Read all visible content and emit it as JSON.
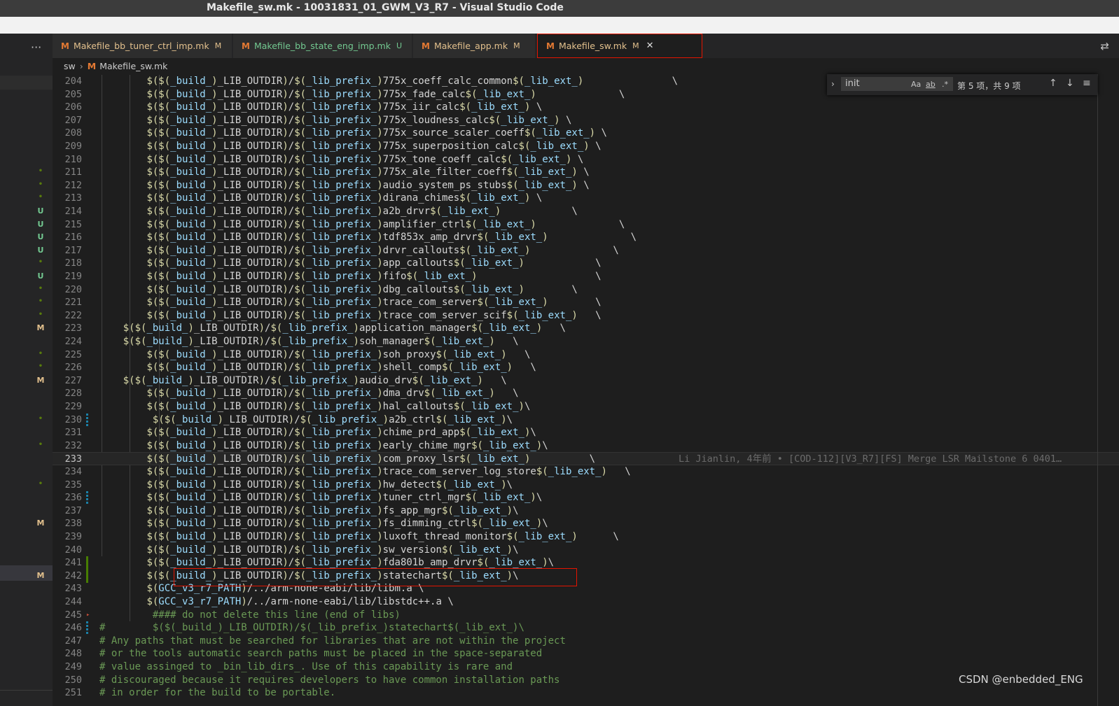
{
  "window": {
    "title": "Makefile_sw.mk - 10031831_01_GWM_V3_R7 - Visual Studio Code"
  },
  "tabs": [
    {
      "label": "Makefile_bb_tuner_ctrl_imp.mk",
      "status": "M",
      "status_color": "#e2c08d",
      "text_color": "#e2c08d"
    },
    {
      "label": "Makefile_bb_state_eng_imp.mk",
      "status": "U",
      "status_color": "#73c991",
      "text_color": "#73c991"
    },
    {
      "label": "Makefile_app.mk",
      "status": "M",
      "status_color": "#e2c08d",
      "text_color": "#e2c08d"
    },
    {
      "label": "Makefile_sw.mk",
      "status": "M",
      "status_color": "#e2c08d",
      "text_color": "#e2c08d",
      "active": true,
      "close": "✕"
    }
  ],
  "tab_icon_glyph": "M",
  "more_glyph": "···",
  "breadcrumb": {
    "folder": "sw",
    "separator": "›",
    "file": "Makefile_sw.mk"
  },
  "find": {
    "query": "init",
    "match_case": "Aa",
    "whole_word": "ab",
    "regex": ".*",
    "result": "第 5 项，共 9 项",
    "prev": "↑",
    "next": "↓",
    "menu": "≡",
    "toggle": "›"
  },
  "blame": "Li Jianlin, 4年前 • [COD-112][V3_R7][FS] Merge LSR Mailstone 6 0401…",
  "watermark": "CSDN @enbedded_ENG",
  "scm_markers": [
    {
      "line": 211,
      "t": "•"
    },
    {
      "line": 212,
      "t": "•"
    },
    {
      "line": 213,
      "t": "•"
    },
    {
      "line": 214,
      "t": "U"
    },
    {
      "line": 215,
      "t": "U"
    },
    {
      "line": 216,
      "t": "U"
    },
    {
      "line": 217,
      "t": "U"
    },
    {
      "line": 218,
      "t": "•"
    },
    {
      "line": 219,
      "t": "U"
    },
    {
      "line": 220,
      "t": "•"
    },
    {
      "line": 221,
      "t": "•"
    },
    {
      "line": 222,
      "t": "•"
    },
    {
      "line": 223,
      "t": "M"
    },
    {
      "line": 225,
      "t": "•"
    },
    {
      "line": 226,
      "t": "•"
    },
    {
      "line": 227,
      "t": "M"
    },
    {
      "line": 230,
      "t": "•"
    },
    {
      "line": 232,
      "t": "•"
    },
    {
      "line": 235,
      "t": "•"
    },
    {
      "line": 238,
      "t": "M"
    },
    {
      "line": 242,
      "t": "M"
    }
  ],
  "lines": [
    {
      "n": "204",
      "t": "        $($(_build_)_LIB_OUTDIR)/$(_lib_prefix_)775x_coeff_calc_common$(_lib_ext_)               \\"
    },
    {
      "n": "205",
      "t": "        $($(_build_)_LIB_OUTDIR)/$(_lib_prefix_)775x_fade_calc$(_lib_ext_)              \\"
    },
    {
      "n": "206",
      "t": "        $($(_build_)_LIB_OUTDIR)/$(_lib_prefix_)775x_iir_calc$(_lib_ext_) \\"
    },
    {
      "n": "207",
      "t": "        $($(_build_)_LIB_OUTDIR)/$(_lib_prefix_)775x_loudness_calc$(_lib_ext_) \\"
    },
    {
      "n": "208",
      "t": "        $($(_build_)_LIB_OUTDIR)/$(_lib_prefix_)775x_source_scaler_coeff$(_lib_ext_) \\"
    },
    {
      "n": "209",
      "t": "        $($(_build_)_LIB_OUTDIR)/$(_lib_prefix_)775x_superposition_calc$(_lib_ext_) \\"
    },
    {
      "n": "210",
      "t": "        $($(_build_)_LIB_OUTDIR)/$(_lib_prefix_)775x_tone_coeff_calc$(_lib_ext_) \\"
    },
    {
      "n": "211",
      "t": "        $($(_build_)_LIB_OUTDIR)/$(_lib_prefix_)775x_ale_filter_coeff$(_lib_ext_) \\"
    },
    {
      "n": "212",
      "t": "        $($(_build_)_LIB_OUTDIR)/$(_lib_prefix_)audio_system_ps_stubs$(_lib_ext_) \\"
    },
    {
      "n": "213",
      "t": "        $($(_build_)_LIB_OUTDIR)/$(_lib_prefix_)dirana_chimes$(_lib_ext_) \\"
    },
    {
      "n": "214",
      "t": "        $($(_build_)_LIB_OUTDIR)/$(_lib_prefix_)a2b_drvr$(_lib_ext_)            \\"
    },
    {
      "n": "215",
      "t": "        $($(_build_)_LIB_OUTDIR)/$(_lib_prefix_)amplifier_ctrl$(_lib_ext_)              \\"
    },
    {
      "n": "216",
      "t": "        $($(_build_)_LIB_OUTDIR)/$(_lib_prefix_)tdf853x_amp_drvr$(_lib_ext_)              \\"
    },
    {
      "n": "217",
      "t": "        $($(_build_)_LIB_OUTDIR)/$(_lib_prefix_)drvr_callouts$(_lib_ext_)              \\"
    },
    {
      "n": "218",
      "t": "        $($(_build_)_LIB_OUTDIR)/$(_lib_prefix_)app_callouts$(_lib_ext_)            \\"
    },
    {
      "n": "219",
      "t": "        $($(_build_)_LIB_OUTDIR)/$(_lib_prefix_)fifo$(_lib_ext_)                    \\"
    },
    {
      "n": "220",
      "t": "        $($(_build_)_LIB_OUTDIR)/$(_lib_prefix_)dbg_callouts$(_lib_ext_)        \\"
    },
    {
      "n": "221",
      "t": "        $($(_build_)_LIB_OUTDIR)/$(_lib_prefix_)trace_com_server$(_lib_ext_)        \\"
    },
    {
      "n": "222",
      "t": "        $($(_build_)_LIB_OUTDIR)/$(_lib_prefix_)trace_com_server_scif$(_lib_ext_)   \\"
    },
    {
      "n": "223",
      "t": "    $($(_build_)_LIB_OUTDIR)/$(_lib_prefix_)application_manager$(_lib_ext_)   \\"
    },
    {
      "n": "224",
      "t": "    $($(_build_)_LIB_OUTDIR)/$(_lib_prefix_)soh_manager$(_lib_ext_)   \\"
    },
    {
      "n": "225",
      "t": "        $($(_build_)_LIB_OUTDIR)/$(_lib_prefix_)soh_proxy$(_lib_ext_)   \\"
    },
    {
      "n": "226",
      "t": "        $($(_build_)_LIB_OUTDIR)/$(_lib_prefix_)shell_comp$(_lib_ext_)   \\"
    },
    {
      "n": "227",
      "t": "    $($(_build_)_LIB_OUTDIR)/$(_lib_prefix_)audio_drv$(_lib_ext_)   \\"
    },
    {
      "n": "228",
      "t": "        $($(_build_)_LIB_OUTDIR)/$(_lib_prefix_)dma_drv$(_lib_ext_)   \\"
    },
    {
      "n": "229",
      "t": "        $($(_build_)_LIB_OUTDIR)/$(_lib_prefix_)hal_callouts$(_lib_ext_)\\"
    },
    {
      "n": "230",
      "t": "         $($(_build_)_LIB_OUTDIR)/$(_lib_prefix_)a2b_ctrl$(_lib_ext_)\\"
    },
    {
      "n": "231",
      "t": "        $($(_build_)_LIB_OUTDIR)/$(_lib_prefix_)chime_prd_app$(_lib_ext_)\\"
    },
    {
      "n": "232",
      "t": "        $($(_build_)_LIB_OUTDIR)/$(_lib_prefix_)early_chime_mgr$(_lib_ext_)\\"
    },
    {
      "n": "233",
      "t": "        $($(_build_)_LIB_OUTDIR)/$(_lib_prefix_)com_proxy_lsr$(_lib_ext_)          \\",
      "current": true
    },
    {
      "n": "234",
      "t": "        $($(_build_)_LIB_OUTDIR)/$(_lib_prefix_)trace_com_server_log_store$(_lib_ext_)   \\"
    },
    {
      "n": "235",
      "t": "        $($(_build_)_LIB_OUTDIR)/$(_lib_prefix_)hw_detect$(_lib_ext_)\\"
    },
    {
      "n": "236",
      "t": "        $($(_build_)_LIB_OUTDIR)/$(_lib_prefix_)tuner_ctrl_mgr$(_lib_ext_)\\"
    },
    {
      "n": "237",
      "t": "        $($(_build_)_LIB_OUTDIR)/$(_lib_prefix_)fs_app_mgr$(_lib_ext_)\\"
    },
    {
      "n": "238",
      "t": "        $($(_build_)_LIB_OUTDIR)/$(_lib_prefix_)fs_dimming_ctrl$(_lib_ext_)\\"
    },
    {
      "n": "239",
      "t": "        $($(_build_)_LIB_OUTDIR)/$(_lib_prefix_)luxoft_thread_monitor$(_lib_ext_)      \\"
    },
    {
      "n": "240",
      "t": "        $($(_build_)_LIB_OUTDIR)/$(_lib_prefix_)sw_version$(_lib_ext_)\\"
    },
    {
      "n": "241",
      "t": "        $($(_build_)_LIB_OUTDIR)/$(_lib_prefix_)fda801b_amp_drvr$(_lib_ext_)\\"
    },
    {
      "n": "242",
      "t": "        $($(_build_)_LIB_OUTDIR)/$(_lib_prefix_)statechart$(_lib_ext_)\\"
    },
    {
      "n": "243",
      "t": "        $(GCC_v3_r7_PATH)/../arm-none-eabi/lib/libm.a \\"
    },
    {
      "n": "244",
      "t": "        $(GCC_v3_r7_PATH)/../arm-none-eabi/lib/libstdc++.a \\"
    },
    {
      "n": "245",
      "t": "         #### do not delete this line (end of libs)",
      "comment": true
    },
    {
      "n": "246",
      "t": "#        $($(_build_)_LIB_OUTDIR)/$(_lib_prefix_)statechart$(_lib_ext_)\\",
      "comment": true
    },
    {
      "n": "247",
      "t": "# Any paths that must be searched for libraries that are not within the project",
      "comment": true
    },
    {
      "n": "248",
      "t": "# or the tools automatic search paths must be placed in the space-separated",
      "comment": true
    },
    {
      "n": "249",
      "t": "# value assinged to _bin_lib_dirs_. Use of this capability is rare and",
      "comment": true
    },
    {
      "n": "250",
      "t": "# discouraged because it requires developers to have common installation paths",
      "comment": true
    },
    {
      "n": "251",
      "t": "# in order for the build to be portable.",
      "comment": true
    }
  ]
}
